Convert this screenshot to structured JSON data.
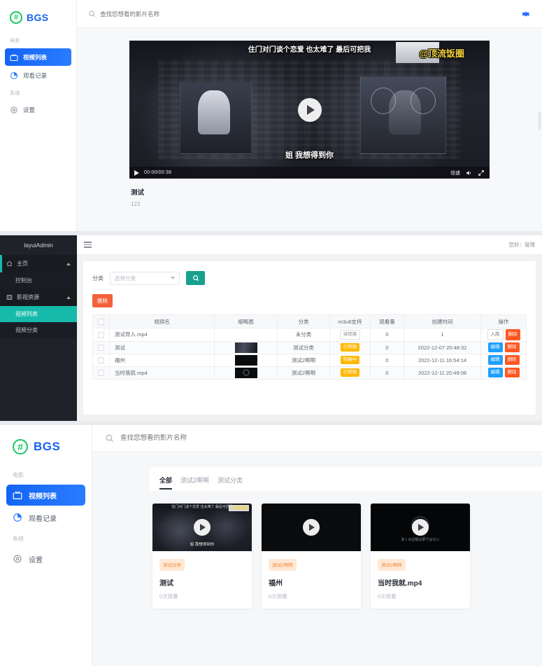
{
  "player_page": {
    "brand": {
      "text": "BGS",
      "mark": "hash-circle"
    },
    "sidebar": {
      "sections": [
        {
          "label": "电影",
          "items": [
            {
              "label": "视频列表",
              "icon": "tv-icon",
              "active": true
            },
            {
              "label": "观看记录",
              "icon": "chart-pie-icon",
              "active": false
            }
          ]
        },
        {
          "label": "系统",
          "items": [
            {
              "label": "设置",
              "icon": "gear-icon",
              "active": false
            }
          ]
        }
      ]
    },
    "search": {
      "placeholder": "查找您想看的影片名称",
      "value": ""
    },
    "settings_icon": "gear-icon",
    "video": {
      "subtitle_top": "住门对门谈个恋爱  也太难了  最后可把我",
      "subtitle_bottom": "姐 我想得到你",
      "watermark": "@顶流饭圈",
      "controls": {
        "play": "play-icon",
        "time": "00:00/00:38",
        "speed_label": "倍速",
        "volume": "volume-icon",
        "fullscreen": "fullscreen-icon"
      }
    },
    "meta": {
      "title": "测试",
      "description": "123"
    }
  },
  "admin_page": {
    "logo": "layuiAdmin",
    "nav": [
      {
        "label": "主页",
        "icon": "home-icon",
        "type": "top",
        "expanded": true
      },
      {
        "label": "控制台",
        "type": "child",
        "selected": false
      },
      {
        "label": "影视资源",
        "icon": "film-icon",
        "type": "top",
        "expanded": true
      },
      {
        "label": "视频列表",
        "type": "child",
        "selected": true
      },
      {
        "label": "视频分类",
        "type": "child",
        "selected": false
      }
    ],
    "header": {
      "menu_icon": "hamburger-icon",
      "greeting": "您好：管理"
    },
    "filter": {
      "label": "分类",
      "select_placeholder": "选择分类",
      "search_icon": "search-icon"
    },
    "bulk_delete_label": "删除",
    "table": {
      "columns": [
        "视频名",
        "缩略图",
        "分类",
        "m3u8支持",
        "观看量",
        "创建时间",
        "操作"
      ],
      "rows": [
        {
          "name": "测试导入.mp4",
          "thumb": "none",
          "category": "未分类",
          "m3u8": "待转换",
          "m3u8_style": "wait",
          "views": "0",
          "created": "1",
          "action_primary": "入库",
          "action_primary_style": "plain",
          "action_delete": "删除"
        },
        {
          "name": "测试",
          "thumb": "scene",
          "category": "测试分类",
          "m3u8": "已转换",
          "m3u8_style": "orange",
          "views": "0",
          "created": "2022-12-07 20:48:32",
          "action_primary": "编辑",
          "action_primary_style": "blue",
          "action_delete": "删除"
        },
        {
          "name": "福州",
          "thumb": "dark",
          "category": "测试2啊啊",
          "m3u8": "转换中",
          "m3u8_style": "orange",
          "views": "0",
          "created": "2022-12-11 16:54:14",
          "action_primary": "编辑",
          "action_primary_style": "blue",
          "action_delete": "删除"
        },
        {
          "name": "当时我就.mp4",
          "thumb": "ring",
          "category": "测试2啊啊",
          "m3u8": "已转换",
          "m3u8_style": "orange",
          "views": "0",
          "created": "2022-12-11 20:49:08",
          "action_primary": "编辑",
          "action_primary_style": "blue",
          "action_delete": "删除"
        }
      ]
    }
  },
  "grid_page": {
    "brand": {
      "text": "BGS",
      "mark": "hash-circle"
    },
    "sidebar": {
      "sections": [
        {
          "label": "电影",
          "items": [
            {
              "label": "视频列表",
              "icon": "tv-icon",
              "active": true
            },
            {
              "label": "观看记录",
              "icon": "chart-pie-icon",
              "active": false
            }
          ]
        },
        {
          "label": "系统",
          "items": [
            {
              "label": "设置",
              "icon": "gear-icon",
              "active": false
            }
          ]
        }
      ]
    },
    "search": {
      "placeholder": "查找您想看的影片名称",
      "value": ""
    },
    "tabs": [
      {
        "label": "全部",
        "active": true
      },
      {
        "label": "测试2啊啊",
        "active": false
      },
      {
        "label": "测试分类",
        "active": false
      }
    ],
    "cards": [
      {
        "title": "测试",
        "tag": "测试分类",
        "views": "0次观看",
        "thumb": "scene",
        "thumb_caption": "姐 我想得到你",
        "thumb_watermark": "@顶流饭圈"
      },
      {
        "title": "福州",
        "tag": "测试2啊啊",
        "views": "0次观看",
        "thumb": "dark"
      },
      {
        "title": "当时我就.mp4",
        "tag": "测试2啊啊",
        "views": "0次观看",
        "thumb": "ring",
        "thumb_caption": "多くの記憶は夢ではない"
      }
    ]
  }
}
